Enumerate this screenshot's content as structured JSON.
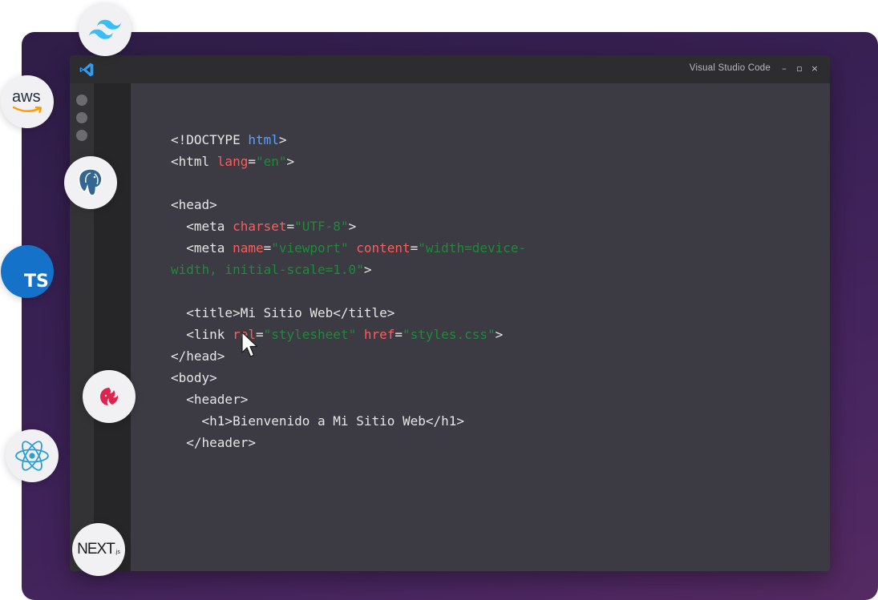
{
  "window": {
    "title": "Visual Studio Code",
    "controls": {
      "minimize": "–",
      "maximize": "▫",
      "close": "×"
    }
  },
  "code_lines": [
    [
      {
        "t": "<!DOCTYPE ",
        "c": "plain"
      },
      {
        "t": "html",
        "c": "kw"
      },
      {
        "t": ">",
        "c": "plain"
      }
    ],
    [
      {
        "t": "<html ",
        "c": "plain"
      },
      {
        "t": "lang",
        "c": "attr"
      },
      {
        "t": "=",
        "c": "plain"
      },
      {
        "t": "\"en\"",
        "c": "str"
      },
      {
        "t": ">",
        "c": "plain"
      }
    ],
    [],
    [
      {
        "t": "<head>",
        "c": "plain"
      }
    ],
    [
      {
        "t": "  <meta ",
        "c": "plain"
      },
      {
        "t": "charset",
        "c": "attr"
      },
      {
        "t": "=",
        "c": "plain"
      },
      {
        "t": "\"UTF-8\"",
        "c": "str"
      },
      {
        "t": ">",
        "c": "plain"
      }
    ],
    [
      {
        "t": "  <meta ",
        "c": "plain"
      },
      {
        "t": "name",
        "c": "attr"
      },
      {
        "t": "=",
        "c": "plain"
      },
      {
        "t": "\"viewport\"",
        "c": "str"
      },
      {
        "t": " ",
        "c": "plain"
      },
      {
        "t": "content",
        "c": "attr"
      },
      {
        "t": "=",
        "c": "plain"
      },
      {
        "t": "\"width=device-",
        "c": "str"
      }
    ],
    [
      {
        "t": "width, initial-scale=1.0\"",
        "c": "str"
      },
      {
        "t": ">",
        "c": "plain"
      }
    ],
    [],
    [
      {
        "t": "  <title>Mi Sitio Web</title>",
        "c": "plain"
      }
    ],
    [
      {
        "t": "  <link ",
        "c": "plain"
      },
      {
        "t": "rel",
        "c": "attr"
      },
      {
        "t": "=",
        "c": "plain"
      },
      {
        "t": "\"stylesheet\"",
        "c": "str"
      },
      {
        "t": " ",
        "c": "plain"
      },
      {
        "t": "href",
        "c": "attr"
      },
      {
        "t": "=",
        "c": "plain"
      },
      {
        "t": "\"styles.css\"",
        "c": "str"
      },
      {
        "t": ">",
        "c": "plain"
      }
    ],
    [
      {
        "t": "</head>",
        "c": "plain"
      }
    ],
    [
      {
        "t": "<body>",
        "c": "plain"
      }
    ],
    [
      {
        "t": "  <header>",
        "c": "plain"
      }
    ],
    [
      {
        "t": "    <h1>Bienvenido a Mi Sitio Web</h1>",
        "c": "plain"
      }
    ],
    [
      {
        "t": "  </header>",
        "c": "plain"
      }
    ]
  ],
  "tech_badges": {
    "aws_label": "aws",
    "typescript_label": "TS",
    "next_label": "NEXT",
    "next_suffix": ".js"
  },
  "colors": {
    "keyword": "#5aa2ff",
    "attribute": "#ff5b5b",
    "string": "#1e8a3a",
    "editor_bg": "#3c3b43",
    "typescript": "#1572c9",
    "tailwind": "#38bdf8",
    "react": "#2a9fd6",
    "nest": "#e0234e"
  }
}
